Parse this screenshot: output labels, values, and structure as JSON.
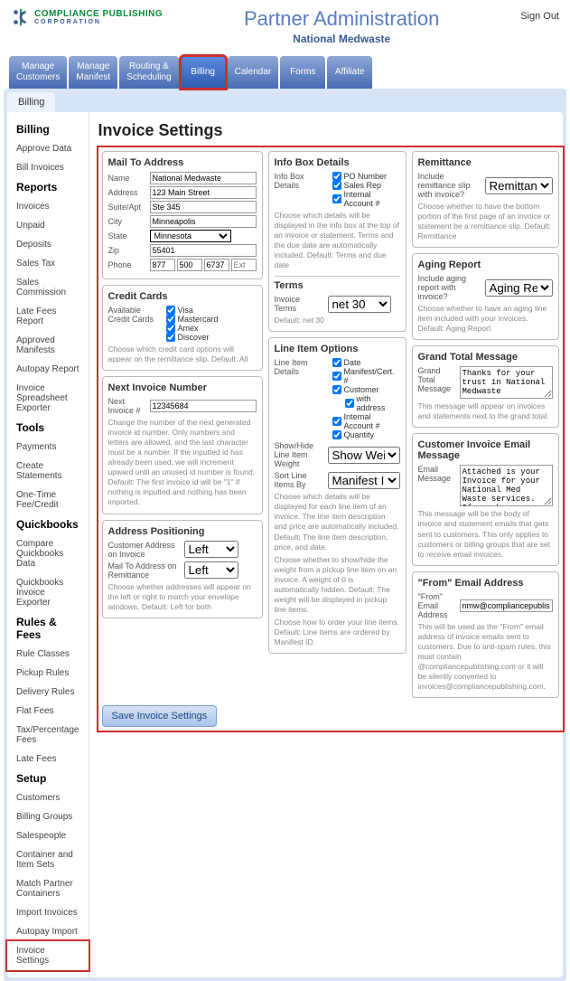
{
  "header": {
    "logo_main": "COMPLIANCE PUBLISHING",
    "logo_sub": "CORPORATION",
    "title": "Partner Administration",
    "subtitle": "National Medwaste",
    "signout": "Sign Out"
  },
  "nav": [
    "Manage\nCustomers",
    "Manage\nManifest",
    "Routing &\nScheduling",
    "Billing",
    "Calendar",
    "Forms",
    "Affiliate"
  ],
  "nav_active": 3,
  "tab": "Billing",
  "sidebar": {
    "groups": [
      {
        "title": "Billing",
        "items": [
          "Approve Data",
          "Bill Invoices"
        ]
      },
      {
        "title": "Reports",
        "items": [
          "Invoices",
          "Unpaid",
          "Deposits",
          "Sales Tax",
          "Sales Commission",
          "Late Fees Report",
          "Approved Manifests",
          "Autopay Report",
          "Invoice Spreadsheet Exporter"
        ]
      },
      {
        "title": "Tools",
        "items": [
          "Payments",
          "Create Statements",
          "One-Time Fee/Credit"
        ]
      },
      {
        "title": "Quickbooks",
        "items": [
          "Compare Quickbooks Data",
          "Quickbooks Invoice Exporter"
        ]
      },
      {
        "title": "Rules & Fees",
        "items": [
          "Rule Classes",
          "Pickup Rules",
          "Delivery Rules",
          "Flat Fees",
          "Tax/Percentage Fees",
          "Late Fees"
        ]
      },
      {
        "title": "Setup",
        "items": [
          "Customers",
          "Billing Groups",
          "Salespeople",
          "Container and Item Sets",
          "Match Partner Containers",
          "Import Invoices",
          "Autopay Import",
          "Invoice Settings"
        ]
      }
    ],
    "selected": "Invoice Settings"
  },
  "page_title": "Invoice Settings",
  "mailto": {
    "heading": "Mail To Address",
    "name_lbl": "Name",
    "name": "National Medwaste",
    "addr_lbl": "Address",
    "addr": "123 Main Street",
    "suite_lbl": "Suite/Apt",
    "suite": "Ste 345",
    "city_lbl": "City",
    "city": "Minneapolis",
    "state_lbl": "State",
    "state": "Minnesota",
    "zip_lbl": "Zip",
    "zip": "55401",
    "phone_lbl": "Phone",
    "phone1": "877",
    "phone2": "500",
    "phone3": "6737",
    "ext_ph": "Ext"
  },
  "cc": {
    "heading": "Credit Cards",
    "label": "Available Credit Cards",
    "opts": [
      "Visa",
      "Mastercard",
      "Amex",
      "Discover"
    ],
    "help": "Choose which credit card options will appear on the remittance slip. Default: All"
  },
  "nextinv": {
    "heading": "Next Invoice Number",
    "label": "Next Invoice #",
    "value": "12345684",
    "help": "Change the number of the next generated invoice id number. Only numbers and letters are allowed, and the last character must be a number. If the inputted id has already been used, we will increment upward until an unused id number is found. Default: The first invoice id will be \"1\" if nothing is inputted and nothing has been imported."
  },
  "addrpos": {
    "heading": "Address Positioning",
    "l1": "Customer Address on Invoice",
    "v1": "Left",
    "l2": "Mail To Address on Remittance",
    "v2": "Left",
    "help": "Choose whether addresses will appear on the left or right to match your envelope windows. Default: Left for both"
  },
  "infobox": {
    "heading": "Info Box Details",
    "label": "Info Box Details",
    "opts": [
      "PO Number",
      "Sales Rep",
      "Internal Account #"
    ],
    "help": "Choose which details will be displayed in the info box at the top of an invoice or statement. Terms and the due date are automatically included. Default: Terms and due date"
  },
  "terms": {
    "heading": "Terms",
    "label": "Invoice Terms",
    "value": "net 30",
    "help": "Default: net 30"
  },
  "lineitem": {
    "heading": "Line Item Options",
    "label": "Line Item Details",
    "opts": [
      "Date",
      "Manifest/Cert. #",
      "Customer",
      "with address",
      "Internal Account #",
      "Quantity"
    ],
    "sh_label": "Show/Hide Line Item Weight",
    "sh_value": "Show Weig",
    "sort_label": "Sort Line Items By",
    "sort_value": "Manifest ID",
    "help1": "Choose which details will be displayed for each line item of an invoice. The line item description and price are automatically included. Default: The line item description, price, and date.",
    "help2": "Choose whether to show/hide the weight from a pickup line item on an invoice. A weight of 0 is automatically hidden. Default: The weight will be displayed in pickup line items.",
    "help3": "Choose how to order your line items. Default: Line items are ordered by Manifest ID."
  },
  "remit": {
    "heading": "Remittance",
    "label": "Include remittance slip with invoice?",
    "value": "Remittance",
    "help": "Choose whether to have the bottom portion of the first page of an invoice or statement be a remittance slip. Default: Remittance"
  },
  "aging": {
    "heading": "Aging Report",
    "label": "Include aging report with invoice?",
    "value": "Aging Repo",
    "help": "Choose whether to have an aging line item included with your invoices. Default: Aging Report"
  },
  "gtm": {
    "heading": "Grand Total Message",
    "label": "Grand Total Message",
    "value": "Thanks for your trust in National Medwaste",
    "help": "This message will appear on invoices and statements next to the grand total."
  },
  "email": {
    "heading": "Customer Invoice Email Message",
    "label": "Email Message",
    "value": "Attached is your Invoice for your National Med Waste services.  If you have",
    "help": "This message will be the body of invoice and statement emails that gets sent to customers. This only applies to customers or billing groups that are set to receive email invoices."
  },
  "from": {
    "heading": "\"From\" Email Address",
    "label": "\"From\" Email Address",
    "value": "nmw@compliancepublishing.c",
    "help": "This will be used as the \"From\" email address of invoice emails sent to customers. Due to anti-spam rules, this must contain @compliancepublishing.com or it will be silently converted to invoices@compliancepublishing.com."
  },
  "save_btn": "Save Invoice Settings"
}
